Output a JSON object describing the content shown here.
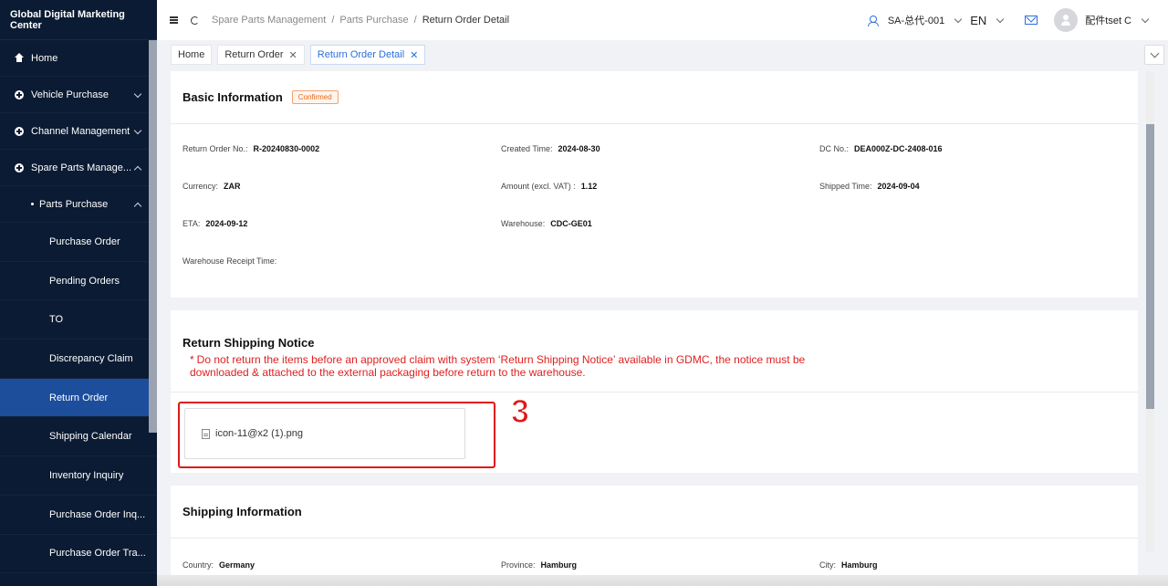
{
  "sidebar": {
    "brand": "Global Digital Marketing Center",
    "items": [
      {
        "label": "Home"
      },
      {
        "label": "Vehicle Purchase"
      },
      {
        "label": "Channel Management"
      },
      {
        "label": "Spare Parts Manage..."
      }
    ],
    "parts_purchase": "Parts Purchase",
    "sub_items": [
      {
        "label": "Purchase Order"
      },
      {
        "label": "Pending Orders"
      },
      {
        "label": "TO"
      },
      {
        "label": "Discrepancy Claim"
      },
      {
        "label": "Return Order"
      },
      {
        "label": "Shipping Calendar"
      },
      {
        "label": "Inventory Inquiry"
      },
      {
        "label": "Purchase Order Inq..."
      },
      {
        "label": "Purchase Order Tra..."
      }
    ]
  },
  "header": {
    "breadcrumb": [
      "Spare Parts Management",
      "Parts Purchase",
      "Return Order Detail"
    ],
    "account": "SA-总代-001",
    "language": "EN",
    "user": "配件tset C"
  },
  "tabs": [
    {
      "label": "Home"
    },
    {
      "label": "Return Order"
    },
    {
      "label": "Return Order Detail"
    }
  ],
  "basic_info": {
    "title": "Basic Information",
    "status": "Confirmed",
    "fields": [
      {
        "label": "Return Order No.:",
        "value": "R-20240830-0002"
      },
      {
        "label": "Created Time:",
        "value": "2024-08-30"
      },
      {
        "label": "DC No.:",
        "value": "DEA000Z-DC-2408-016"
      },
      {
        "label": "Currency:",
        "value": "ZAR"
      },
      {
        "label": "Amount (excl. VAT) :",
        "value": "1.12"
      },
      {
        "label": "Shipped Time:",
        "value": "2024-09-04"
      },
      {
        "label": "ETA:",
        "value": "2024-09-12"
      },
      {
        "label": "Warehouse:",
        "value": "CDC-GE01"
      },
      {
        "label": "",
        "value": ""
      },
      {
        "label": "Warehouse Receipt Time:",
        "value": ""
      }
    ]
  },
  "notice": {
    "title": "Return Shipping Notice",
    "warning": "Do not return the items before an approved claim with system ‘Return Shipping Notice’ available in GDMC, the notice must be downloaded & attached to the external packaging before return to the warehouse.",
    "star": "*",
    "file_name": "icon-11@x2 (1).png",
    "step_number": "3"
  },
  "shipping": {
    "title": "Shipping Information",
    "fields": [
      {
        "label": "Country:",
        "value": "Germany"
      },
      {
        "label": "Province:",
        "value": "Hamburg"
      },
      {
        "label": "City:",
        "value": "Hamburg"
      }
    ]
  },
  "colors": {
    "sidebar_bg": "#0b1b33",
    "active_item": "#1d4e9c",
    "accent": "#2a6fdb",
    "warning": "#e02020",
    "badge": "#e86a1b"
  }
}
